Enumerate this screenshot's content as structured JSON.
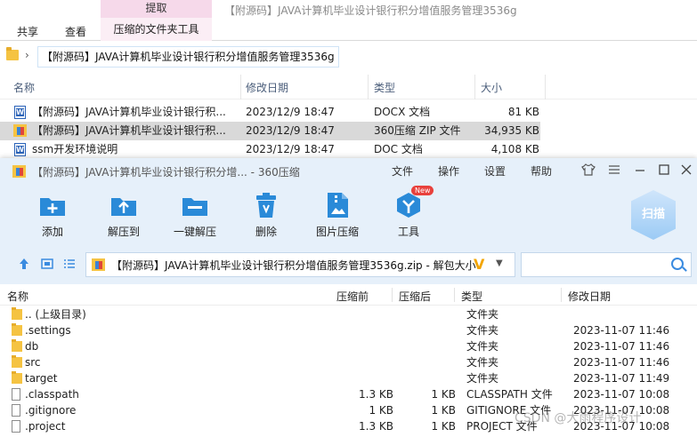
{
  "explorer": {
    "ribbon": {
      "tabs": [
        "共享",
        "查看"
      ],
      "context_header": "提取",
      "context_tab": "压缩的文件夹工具",
      "window_title": "【附源码】JAVA计算机毕业设计银行积分增值服务管理3536g"
    },
    "address": {
      "separator": "›",
      "path": "【附源码】JAVA计算机毕业设计银行积分增值服务管理3536g"
    },
    "columns": {
      "name": "名称",
      "modified": "修改日期",
      "type": "类型",
      "size": "大小"
    },
    "rows": [
      {
        "name": "【附源码】JAVA计算机毕业设计银行积...",
        "modified": "2023/12/9 18:47",
        "type": "DOCX 文档",
        "size": "81 KB",
        "icon": "word-doc-icon"
      },
      {
        "name": "【附源码】JAVA计算机毕业设计银行积...",
        "modified": "2023/12/9 18:47",
        "type": "360压缩 ZIP 文件",
        "size": "34,935 KB",
        "icon": "zip-icon"
      },
      {
        "name": "ssm开发环境说明",
        "modified": "2023/12/9 18:47",
        "type": "DOC 文档",
        "size": "4,108 KB",
        "icon": "word-doc-icon"
      }
    ]
  },
  "zip": {
    "title": "【附源码】JAVA计算机毕业设计银行积分增... - 360压缩",
    "menu": [
      "文件",
      "操作",
      "设置",
      "帮助"
    ],
    "toolbar": [
      {
        "label": "添加",
        "icon": "add-icon"
      },
      {
        "label": "解压到",
        "icon": "extract-to-icon"
      },
      {
        "label": "一键解压",
        "icon": "one-click-extract-icon"
      },
      {
        "label": "删除",
        "icon": "delete-icon"
      },
      {
        "label": "图片压缩",
        "icon": "image-compress-icon"
      },
      {
        "label": "工具",
        "icon": "tools-icon"
      }
    ],
    "new_badge": "New",
    "scan_label": "扫描",
    "path": "【附源码】JAVA计算机毕业设计银行积分增值服务管理3536g.zip - 解包大小",
    "columns": {
      "name": "名称",
      "compressed": "压缩前",
      "after": "压缩后",
      "type": "类型",
      "modified": "修改日期"
    },
    "rows": [
      {
        "name": ".. (上级目录)",
        "before": "",
        "after": "",
        "type": "文件夹",
        "modified": "",
        "kind": "folder"
      },
      {
        "name": ".settings",
        "before": "",
        "after": "",
        "type": "文件夹",
        "modified": "2023-11-07 11:46",
        "kind": "folder"
      },
      {
        "name": "db",
        "before": "",
        "after": "",
        "type": "文件夹",
        "modified": "2023-11-07 11:46",
        "kind": "folder"
      },
      {
        "name": "src",
        "before": "",
        "after": "",
        "type": "文件夹",
        "modified": "2023-11-07 11:46",
        "kind": "folder"
      },
      {
        "name": "target",
        "before": "",
        "after": "",
        "type": "文件夹",
        "modified": "2023-11-07 11:49",
        "kind": "folder"
      },
      {
        "name": ".classpath",
        "before": "1.3 KB",
        "after": "1 KB",
        "type": "CLASSPATH 文件",
        "modified": "2023-11-07 10:08",
        "kind": "file"
      },
      {
        "name": ".gitignore",
        "before": "1 KB",
        "after": "1 KB",
        "type": "GITIGNORE 文件",
        "modified": "2023-11-07 10:08",
        "kind": "file"
      },
      {
        "name": ".project",
        "before": "1.3 KB",
        "after": "1 KB",
        "type": "PROJECT 文件",
        "modified": "2023-11-07 10:08",
        "kind": "file"
      }
    ]
  },
  "watermark": "CSDN @大雨程序设计",
  "colors": {
    "accent": "#3a8be0",
    "zip_bg": "#e6f0fa",
    "context_tab": "#f6d9ea"
  }
}
